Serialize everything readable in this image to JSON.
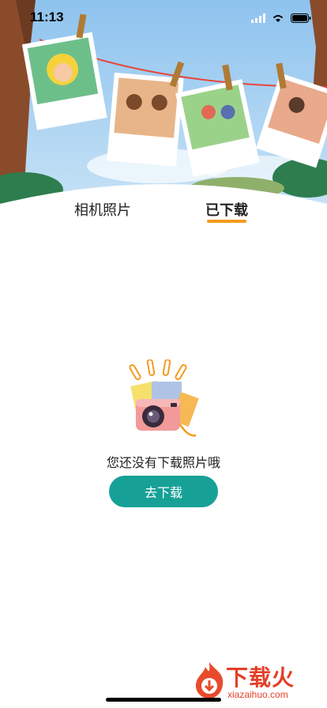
{
  "status_bar": {
    "time": "11:13"
  },
  "tabs": [
    {
      "label": "相机照片"
    },
    {
      "label": "已下载"
    }
  ],
  "empty_state": {
    "message": "您还没有下载照片哦",
    "button_label": "去下载"
  },
  "watermark": {
    "brand": "下载火",
    "url": "xiazaihuo.com"
  },
  "colors": {
    "accent": "#f39a1e",
    "button": "#17a196",
    "sky": "#9fcdf0"
  }
}
